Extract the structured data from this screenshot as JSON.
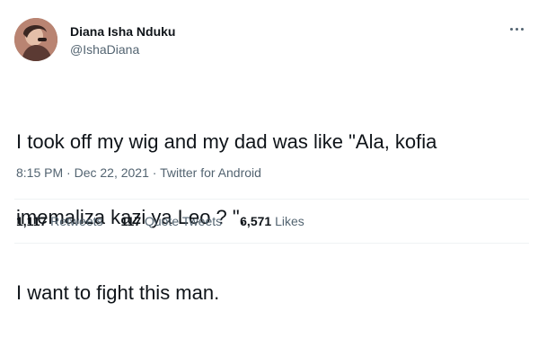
{
  "author": {
    "display_name": "Diana Isha Nduku",
    "handle": "@IshaDiana"
  },
  "icons": {
    "more": "more-options-icon",
    "avatar": "profile-photo"
  },
  "tweet": {
    "lines": [
      "I took off my wig and my dad was like \"Ala, kofia",
      "imemaliza kazi ya Leo ? \".",
      "I want to fight this man."
    ]
  },
  "meta": {
    "time": "8:15 PM",
    "separator1": " · ",
    "date": "Dec 22, 2021",
    "separator2": " · ",
    "source": "Twitter for Android"
  },
  "stats": {
    "retweets_count": "1,117",
    "retweets_label": "Retweets",
    "quotes_count": "117",
    "quotes_label": "Quote Tweets",
    "likes_count": "6,571",
    "likes_label": "Likes"
  },
  "colors": {
    "text": "#0f1419",
    "secondary": "#536471",
    "divider": "#eff3f4"
  }
}
